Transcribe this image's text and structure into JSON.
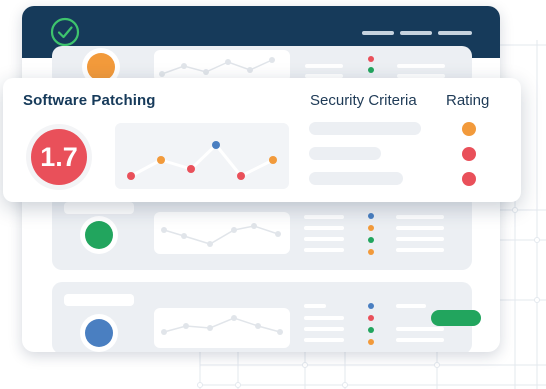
{
  "window": {
    "header_icon": "check-circle-icon",
    "header_bar_color": "#163a5a",
    "menu_icon": "menu-lines-icon"
  },
  "highlight_card": {
    "title": "Software Patching",
    "score": "1.7",
    "score_color": "#e9505a",
    "columns": {
      "criteria": "Security Criteria",
      "rating": "Rating"
    },
    "ratings": [
      {
        "color": "#f29a3b"
      },
      {
        "color": "#e9505a"
      },
      {
        "color": "#e9505a"
      }
    ],
    "sparkline_point_colors": [
      "#e9505a",
      "#f29a3b",
      "#e9505a",
      "#4a7fc1",
      "#e9505a",
      "#f29a3b"
    ]
  },
  "background_cards": [
    {
      "status_color": "#f29a3b",
      "dots": [
        "#e9505a",
        "#22a55e"
      ]
    },
    {
      "status_color": "#22a55e",
      "dots": [
        "#4a7fc1",
        "#f29a3b",
        "#22a55e",
        "#f29a3b"
      ]
    },
    {
      "status_color": "#4a7fc1",
      "dots": [
        "#4a7fc1",
        "#e9505a",
        "#22a55e",
        "#f29a3b"
      ],
      "action_color": "#22a55e"
    }
  ]
}
